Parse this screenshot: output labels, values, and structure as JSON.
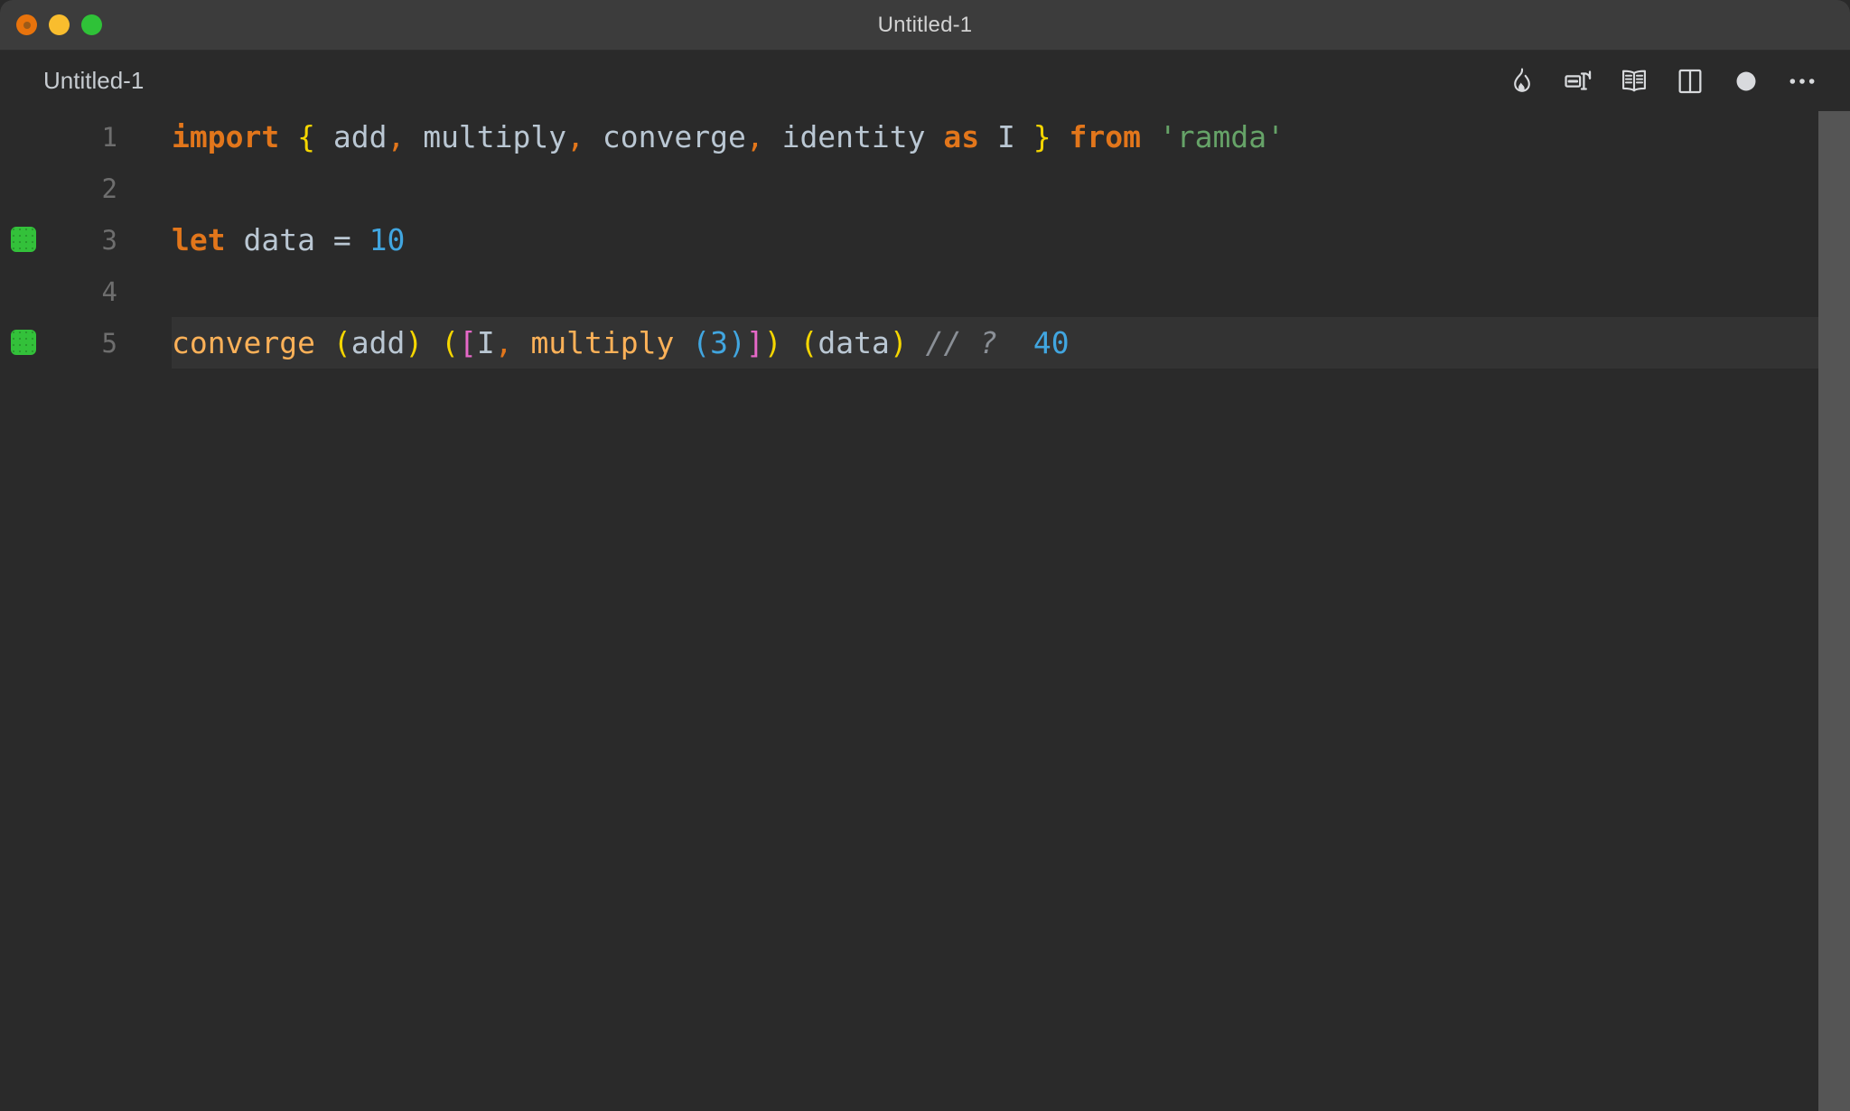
{
  "window": {
    "title": "Untitled-1",
    "traffic_lights": [
      {
        "name": "close",
        "color": "#e8730c"
      },
      {
        "name": "minimize",
        "color": "#f9bd2e"
      },
      {
        "name": "maximize",
        "color": "#2fc238"
      }
    ]
  },
  "tabbar": {
    "tab_label": "Untitled-1",
    "actions": [
      {
        "name": "quokka-start-icon",
        "label": "flame"
      },
      {
        "name": "align-editor-icon",
        "label": "split-align"
      },
      {
        "name": "open-preview-icon",
        "label": "book"
      },
      {
        "name": "split-editor-icon",
        "label": "split-right"
      },
      {
        "name": "unsaved-dot-icon",
        "label": "dot"
      },
      {
        "name": "more-actions-icon",
        "label": "ellipsis"
      }
    ]
  },
  "editor": {
    "language": "javascript",
    "lines": [
      {
        "number": "1",
        "marker": null,
        "highlight": false,
        "tokens": [
          {
            "text": "import",
            "cls": "t-kw"
          },
          {
            "text": " ",
            "cls": "t-id"
          },
          {
            "text": "{",
            "cls": "t-brace"
          },
          {
            "text": " add",
            "cls": "t-id"
          },
          {
            "text": ",",
            "cls": "t-punct"
          },
          {
            "text": " multiply",
            "cls": "t-id"
          },
          {
            "text": ",",
            "cls": "t-punct"
          },
          {
            "text": " converge",
            "cls": "t-id"
          },
          {
            "text": ",",
            "cls": "t-punct"
          },
          {
            "text": " identity ",
            "cls": "t-id"
          },
          {
            "text": "as",
            "cls": "t-kw"
          },
          {
            "text": " I ",
            "cls": "t-id"
          },
          {
            "text": "}",
            "cls": "t-brace"
          },
          {
            "text": " ",
            "cls": "t-id"
          },
          {
            "text": "from",
            "cls": "t-kw"
          },
          {
            "text": " ",
            "cls": "t-id"
          },
          {
            "text": "'ramda'",
            "cls": "t-str"
          }
        ]
      },
      {
        "number": "2",
        "marker": null,
        "highlight": false,
        "tokens": []
      },
      {
        "number": "3",
        "marker": "cov",
        "highlight": false,
        "tokens": [
          {
            "text": "let",
            "cls": "t-kw"
          },
          {
            "text": " data ",
            "cls": "t-id"
          },
          {
            "text": "=",
            "cls": "t-op"
          },
          {
            "text": " ",
            "cls": "t-id"
          },
          {
            "text": "10",
            "cls": "t-num"
          }
        ]
      },
      {
        "number": "4",
        "marker": null,
        "highlight": false,
        "tokens": []
      },
      {
        "number": "5",
        "marker": "cov",
        "highlight": true,
        "tokens": [
          {
            "text": "converge",
            "cls": "t-fn"
          },
          {
            "text": " ",
            "cls": "t-id"
          },
          {
            "text": "(",
            "cls": "t-paren-y"
          },
          {
            "text": "add",
            "cls": "t-id"
          },
          {
            "text": ")",
            "cls": "t-paren-y"
          },
          {
            "text": " ",
            "cls": "t-id"
          },
          {
            "text": "(",
            "cls": "t-paren-y"
          },
          {
            "text": "[",
            "cls": "t-bracket"
          },
          {
            "text": "I",
            "cls": "t-id"
          },
          {
            "text": ",",
            "cls": "t-punct"
          },
          {
            "text": " ",
            "cls": "t-id"
          },
          {
            "text": "multiply",
            "cls": "t-fn"
          },
          {
            "text": " ",
            "cls": "t-id"
          },
          {
            "text": "(",
            "cls": "t-paren-b"
          },
          {
            "text": "3",
            "cls": "t-num"
          },
          {
            "text": ")",
            "cls": "t-paren-b"
          },
          {
            "text": "]",
            "cls": "t-bracket"
          },
          {
            "text": ")",
            "cls": "t-paren-y"
          },
          {
            "text": " ",
            "cls": "t-id"
          },
          {
            "text": "(",
            "cls": "t-paren-y"
          },
          {
            "text": "data",
            "cls": "t-id"
          },
          {
            "text": ")",
            "cls": "t-paren-y"
          },
          {
            "text": " ",
            "cls": "t-id"
          },
          {
            "text": "// ?",
            "cls": "t-comment"
          },
          {
            "text": "  ",
            "cls": "t-id"
          },
          {
            "text": "40",
            "cls": "t-value"
          }
        ]
      }
    ]
  },
  "theme": {
    "background": "#2a2a2a",
    "titlebar": "#3c3c3c",
    "line_highlight": "#333333",
    "gutter_text": "#6e6e6e",
    "coverage_green": "#33c13a",
    "scrollbar": "#555555",
    "keyword": "#e2761b",
    "identifier": "#bac7d3",
    "string": "#66a368",
    "number": "#41a6e0",
    "function": "#fcb158",
    "brace_yellow": "#f5d600",
    "bracket_magenta": "#e668c8",
    "paren_blue": "#41a6e0",
    "comment": "#8a8f96"
  }
}
